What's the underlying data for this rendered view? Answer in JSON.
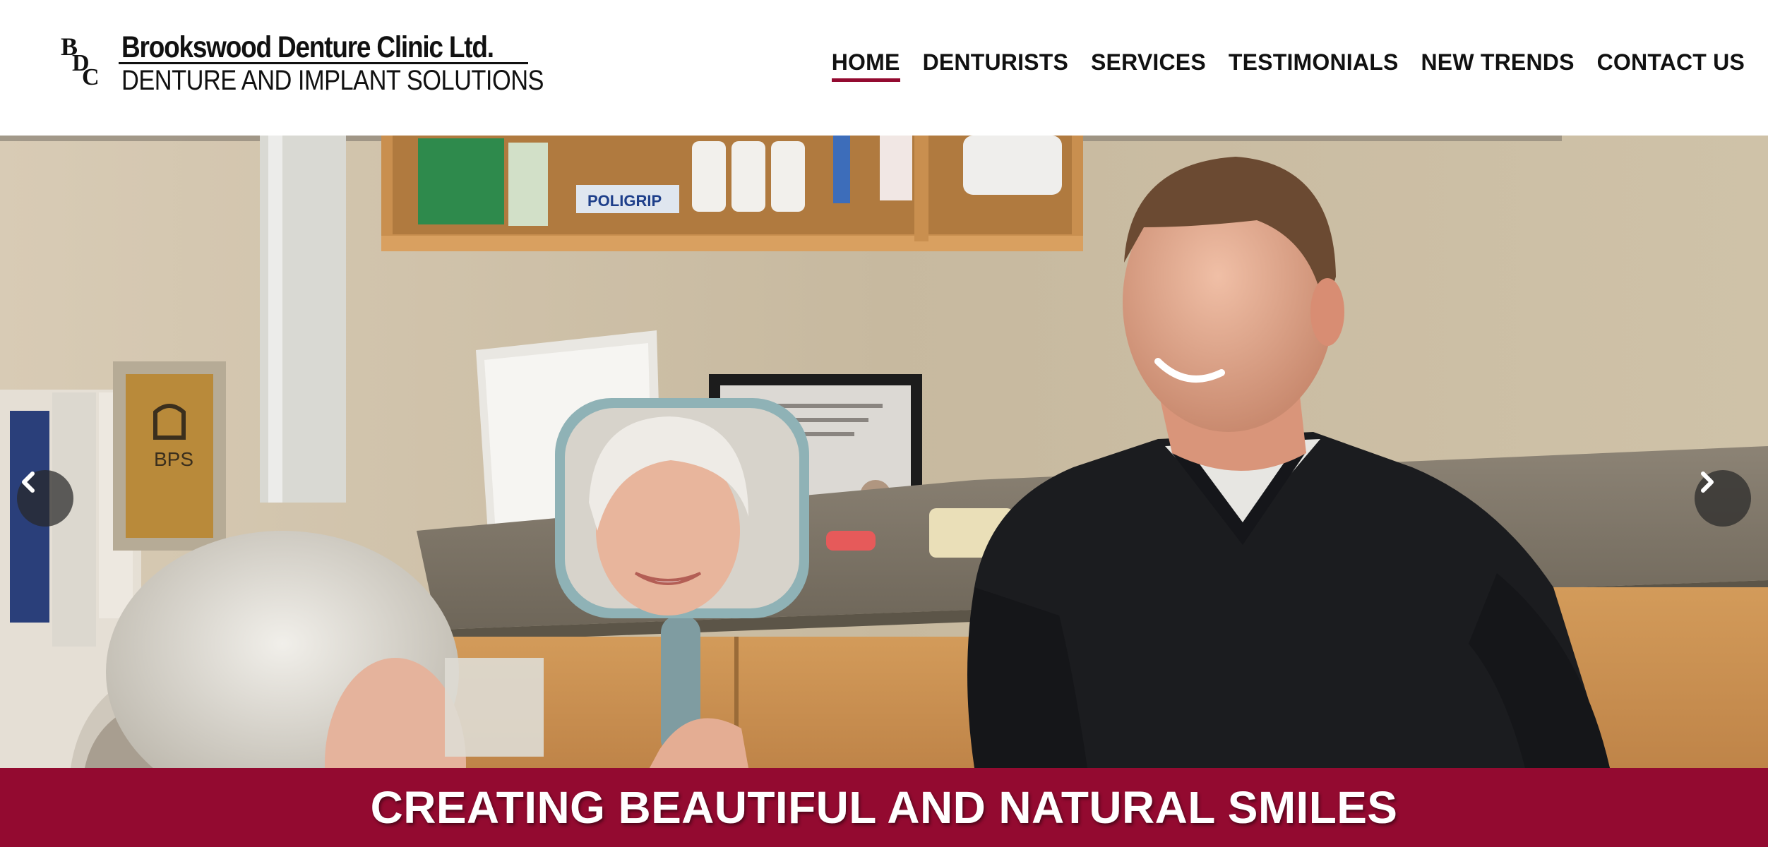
{
  "header": {
    "logo": {
      "monogram": "BDC",
      "name": "Brookswood Denture Clinic Ltd.",
      "tagline": "DENTURE AND IMPLANT SOLUTIONS"
    },
    "nav": [
      {
        "label": "HOME",
        "active": true
      },
      {
        "label": "DENTURISTS",
        "active": false
      },
      {
        "label": "SERVICES",
        "active": false
      },
      {
        "label": "TESTIMONIALS",
        "active": false
      },
      {
        "label": "NEW TRENDS",
        "active": false
      },
      {
        "label": "CONTACT US",
        "active": false
      }
    ]
  },
  "hero": {
    "shelf_product": "POLIGRIP",
    "plaque_text": "BPS",
    "prev_icon": "chevron-left-icon",
    "next_icon": "chevron-right-icon"
  },
  "banner": {
    "title": "CREATING BEAUTIFUL AND NATURAL SMILES"
  },
  "colors": {
    "accent": "#930a30",
    "text": "#111111",
    "background": "#ffffff"
  }
}
